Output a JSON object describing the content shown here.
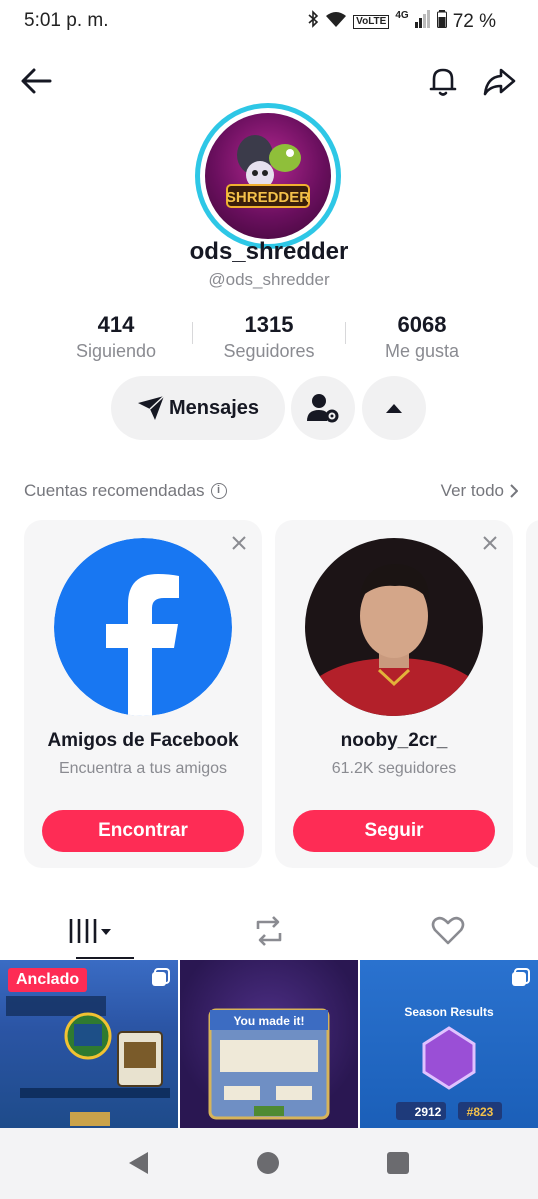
{
  "status_bar": {
    "time": "5:01 p. m.",
    "volte": "VoLTE",
    "network": "4G",
    "battery": "72 %"
  },
  "profile": {
    "avatar_text": "SHREDDER",
    "username": "ods_shredder",
    "handle": "@ods_shredder",
    "stats": [
      {
        "value": "414",
        "label": "Siguiendo"
      },
      {
        "value": "1315",
        "label": "Seguidores"
      },
      {
        "value": "6068",
        "label": "Me gusta"
      }
    ]
  },
  "actions": {
    "message_label": "Mensajes"
  },
  "recommended": {
    "title": "Cuentas recomendadas",
    "see_all": "Ver todo",
    "cards": [
      {
        "name": "Amigos de Facebook",
        "subtitle": "Encuentra a tus amigos",
        "button": "Encontrar"
      },
      {
        "name": "nooby_2cr_",
        "subtitle": "61.2K seguidores",
        "button": "Seguir"
      }
    ]
  },
  "videos": {
    "pinned_label": "Anclado",
    "thumb2_title": "You made it!",
    "thumb3_title": "Season Results",
    "thumb3_values": [
      "2912",
      "#823"
    ]
  },
  "colors": {
    "accent": "#fe2c55",
    "avatar_ring": "#2ec7e6",
    "facebook_blue": "#1877f2"
  }
}
